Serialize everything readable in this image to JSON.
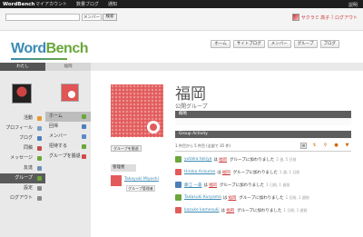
{
  "topbar": {
    "brand": "WordBench",
    "menus": [
      "マイアカウント",
      "数量ブログ",
      "通知"
    ],
    "help": "説明"
  },
  "search": {
    "placeholder": "",
    "scope": "メンバー",
    "button": "検索"
  },
  "account": {
    "name": "サクラミ 高子",
    "separator": "|",
    "logout": "ログアウト"
  },
  "logo": {
    "word": "Word",
    "bench": "Bench"
  },
  "nav": [
    "ホーム",
    "サイトブログ",
    "メンバー",
    "グループ",
    "ブログ"
  ],
  "tabs": {
    "me": "わたし",
    "group": "福岡"
  },
  "left_menu": [
    {
      "label": "活動",
      "color": "#e89a2c"
    },
    {
      "label": "プロフィール",
      "color": "#7aa0c4"
    },
    {
      "label": "ブログ",
      "color": "#4b7fb8"
    },
    {
      "label": "同稿",
      "color": "#c44a4a"
    },
    {
      "label": "メッセージ",
      "color": "#6aa63a"
    },
    {
      "label": "友達",
      "color": "#6f8fb8"
    },
    {
      "label": "グループ",
      "color": "#6aa63a",
      "active": true
    },
    {
      "label": "設定",
      "color": "#8a8a8a"
    },
    {
      "label": "ログアウト",
      "color": "#8a8a8a"
    }
  ],
  "mid_menu": [
    {
      "label": "ホーム",
      "color": "#6aa63a",
      "active": true
    },
    {
      "label": "回帰",
      "color": "#4b7fb8"
    },
    {
      "label": "メンバー",
      "color": "#5a8ac8"
    },
    {
      "label": "招待する",
      "color": "#6aa63a"
    },
    {
      "label": "グループを脱退",
      "color": "#d24a4a"
    }
  ],
  "group": {
    "title": "福岡",
    "subtitle": "公開グループ",
    "small_button": "グループを脱退",
    "admin_label": "管理者",
    "admin_name": "Takayuki Miyoshi",
    "admin_role": "グループ管理者"
  },
  "sections": {
    "summary": "概略",
    "activity": "Group Activity"
  },
  "activity": {
    "count_text": "1 件目から 5 件目 (全部で 35 件)",
    "tools": [
      "≡",
      "↯",
      "⚲",
      "●",
      "▼"
    ],
    "items": [
      {
        "user": "yutaka tokiya",
        "mid": "は",
        "group": "福岡",
        "action": "グループに加わりました",
        "time": "2 週, 5 日前",
        "color": "#6aa63a"
      },
      {
        "user": "Hiroko Arisume",
        "mid": "は",
        "group": "福岡",
        "action": "グループに加わりました",
        "time": "1 週, 1 日前",
        "color": "#e25b5b"
      },
      {
        "user": "藤江 一貴",
        "mid": "は",
        "group": "福岡",
        "action": "グループに加わりました",
        "time": "1 日前, 1 週前",
        "color": "#4b7fb8"
      },
      {
        "user": "Tadasuki Kuryama",
        "mid": "は",
        "group": "福岡",
        "action": "グループに加わりました",
        "time": "1 日前, 1 週前",
        "color": "#6aa63a"
      },
      {
        "user": "kazuke kamesuki",
        "mid": "は",
        "group": "福岡",
        "action": "グループに加わりました",
        "time": "1 日前, 1 週前",
        "color": "#e25b5b"
      }
    ]
  }
}
